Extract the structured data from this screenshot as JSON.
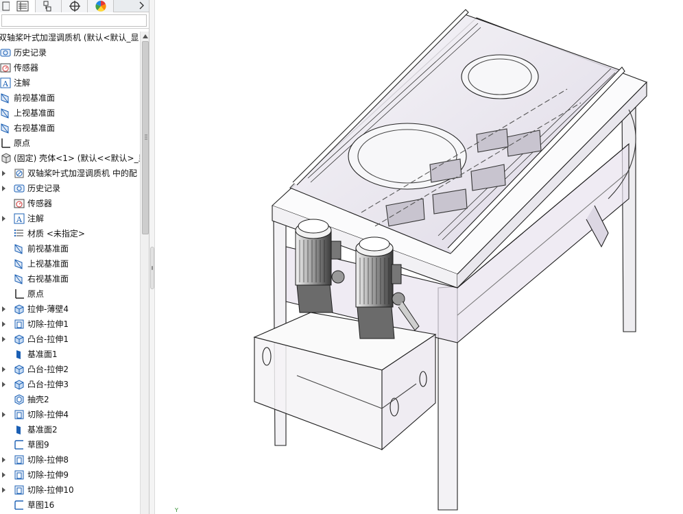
{
  "tree": {
    "root_label": "双轴桨叶式加湿调质机  (默认<默认_显",
    "items": [
      {
        "label": "历史记录",
        "icon": "history-icon",
        "level": 0
      },
      {
        "label": "传感器",
        "icon": "sensor-icon",
        "level": 0
      },
      {
        "label": "注解",
        "icon": "annotation-icon",
        "level": 0
      },
      {
        "label": "前视基准面",
        "icon": "plane-icon",
        "level": 0
      },
      {
        "label": "上视基准面",
        "icon": "plane-icon",
        "level": 0
      },
      {
        "label": "右视基准面",
        "icon": "plane-icon",
        "level": 0
      },
      {
        "label": "原点",
        "icon": "origin-icon",
        "level": 0
      },
      {
        "label": "(固定) 壳体<1> (默认<<默认>_显",
        "icon": "part-icon",
        "level": 0
      },
      {
        "label": "双轴桨叶式加湿调质机 中的配",
        "icon": "mates-icon",
        "level": 1,
        "expander": true
      },
      {
        "label": "历史记录",
        "icon": "history-icon",
        "level": 1,
        "expander": true
      },
      {
        "label": "传感器",
        "icon": "sensor-icon",
        "level": 1
      },
      {
        "label": "注解",
        "icon": "annotation-icon",
        "level": 1,
        "expander": true
      },
      {
        "label": "材质 <未指定>",
        "icon": "material-icon",
        "level": 1
      },
      {
        "label": "前视基准面",
        "icon": "plane-icon",
        "level": 1
      },
      {
        "label": "上视基准面",
        "icon": "plane-icon",
        "level": 1
      },
      {
        "label": "右视基准面",
        "icon": "plane-icon",
        "level": 1
      },
      {
        "label": "原点",
        "icon": "origin-icon",
        "level": 1
      },
      {
        "label": "拉伸-薄壁4",
        "icon": "extrude-icon",
        "level": 1,
        "expander": true
      },
      {
        "label": "切除-拉伸1",
        "icon": "cut-extrude-icon",
        "level": 1,
        "expander": true
      },
      {
        "label": "凸台-拉伸1",
        "icon": "extrude-icon",
        "level": 1,
        "expander": true
      },
      {
        "label": "基准面1",
        "icon": "ref-plane-icon",
        "level": 1
      },
      {
        "label": "凸台-拉伸2",
        "icon": "extrude-icon",
        "level": 1,
        "expander": true
      },
      {
        "label": "凸台-拉伸3",
        "icon": "extrude-icon",
        "level": 1,
        "expander": true
      },
      {
        "label": "抽壳2",
        "icon": "shell-icon",
        "level": 1
      },
      {
        "label": "切除-拉伸4",
        "icon": "cut-extrude-icon",
        "level": 1,
        "expander": true
      },
      {
        "label": "基准面2",
        "icon": "ref-plane-icon",
        "level": 1
      },
      {
        "label": "草图9",
        "icon": "sketch-icon",
        "level": 1
      },
      {
        "label": "切除-拉伸8",
        "icon": "cut-extrude-icon",
        "level": 1,
        "expander": true
      },
      {
        "label": "切除-拉伸9",
        "icon": "cut-extrude-icon",
        "level": 1,
        "expander": true
      },
      {
        "label": "切除-拉伸10",
        "icon": "cut-extrude-icon",
        "level": 1,
        "expander": true
      },
      {
        "label": "草图16",
        "icon": "sketch-icon",
        "level": 1
      }
    ]
  },
  "tabs": [
    {
      "name": "feature-manager-tab",
      "icon": "feature-tree-icon"
    },
    {
      "name": "property-manager-tab",
      "icon": "property-list-icon"
    },
    {
      "name": "configuration-manager-tab",
      "icon": "configuration-icon"
    },
    {
      "name": "dimxpert-tab",
      "icon": "crosshair-icon"
    },
    {
      "name": "display-manager-tab",
      "icon": "color-wheel-icon"
    }
  ],
  "viewport": {
    "triad_mark": "Y"
  },
  "colors": {
    "accent": "#1a5fb4",
    "model_line": "#1e1e1e",
    "glass_tint": "#c9c3d6"
  }
}
